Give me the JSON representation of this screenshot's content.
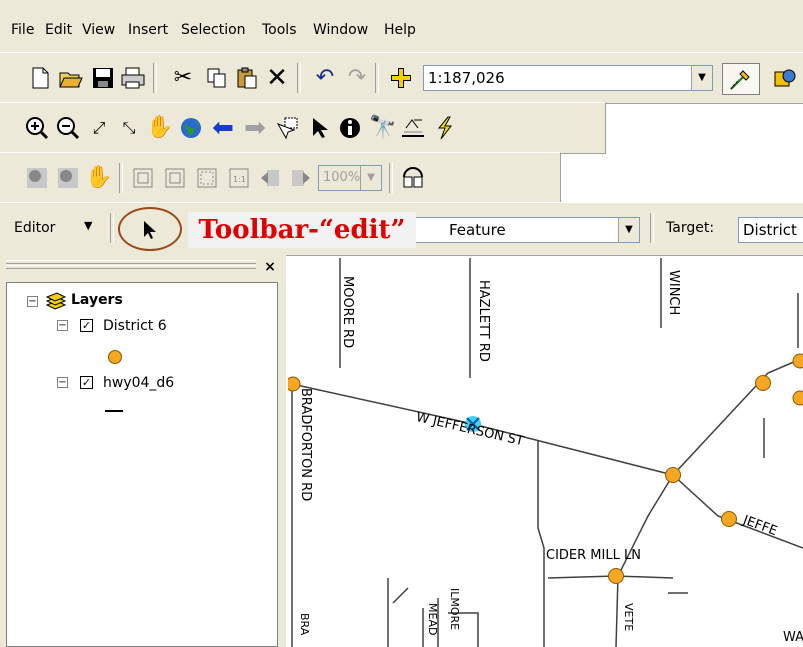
{
  "menu": [
    "File",
    "Edit",
    "View",
    "Insert",
    "Selection",
    "Tools",
    "Window",
    "Help"
  ],
  "toolbar1": {
    "icons": [
      "new-icon",
      "open-icon",
      "save-icon",
      "print-icon",
      "cut-icon",
      "copy-icon",
      "paste-icon",
      "delete-icon",
      "undo-icon",
      "redo-icon",
      "add-data-icon"
    ],
    "scale_value": "1:187,026"
  },
  "toolbar2": {
    "icons": [
      "zoom-in-icon",
      "zoom-out-icon",
      "fixed-zoom-in-icon",
      "fixed-zoom-out-icon",
      "pan-icon",
      "full-extent-icon",
      "back-icon",
      "forward-icon",
      "select-features-icon",
      "select-elements-icon",
      "identify-icon",
      "find-icon",
      "measure-icon",
      "hyperlink-icon"
    ]
  },
  "toolbar3": {
    "zoom_value": "100%"
  },
  "editor": {
    "label": "Editor",
    "task_value": "Feature",
    "target_label": "Target:",
    "target_value": "District"
  },
  "callout": {
    "text": "Toolbar-“edit”"
  },
  "toc": {
    "root": "Layers",
    "layers": [
      {
        "name": "District 6",
        "symbol": "point"
      },
      {
        "name": "hwy04_d6",
        "symbol": "line"
      }
    ]
  },
  "map": {
    "labels": [
      "MOORE RD",
      "HAZLETT RD",
      "WINCH",
      "W JEFFERSON ST",
      "BRADFORTON RD",
      "CIDER MILL LN",
      "JEFFE",
      "ILMORE",
      "MEAD",
      "VETE",
      "BRA",
      "WA"
    ],
    "colors": {
      "node": "#f5a623",
      "node_stroke": "#8a5a00",
      "road": "#404040",
      "selected": "#40d0ff"
    }
  }
}
